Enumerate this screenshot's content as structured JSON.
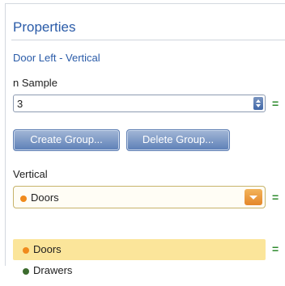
{
  "panel": {
    "title": "Properties",
    "subtitle": "Door Left - Vertical"
  },
  "sample": {
    "label": "n Sample",
    "value": "3",
    "equals": "="
  },
  "buttons": {
    "create": "Create Group...",
    "delete": "Delete Group..."
  },
  "vertical": {
    "label": "Vertical",
    "selected": "Doors",
    "selected_color": "#f08a1c",
    "equals": "="
  },
  "dropdown": {
    "options": [
      {
        "label": "Doors",
        "color": "#f08a1c",
        "highlighted": true
      },
      {
        "label": "Drawers",
        "color": "#3c6b2e",
        "highlighted": false
      }
    ],
    "equals": "="
  },
  "colors": {
    "accent": "#2a5ba8",
    "equals": "#2e8b2e",
    "highlight": "#fbe59a"
  }
}
